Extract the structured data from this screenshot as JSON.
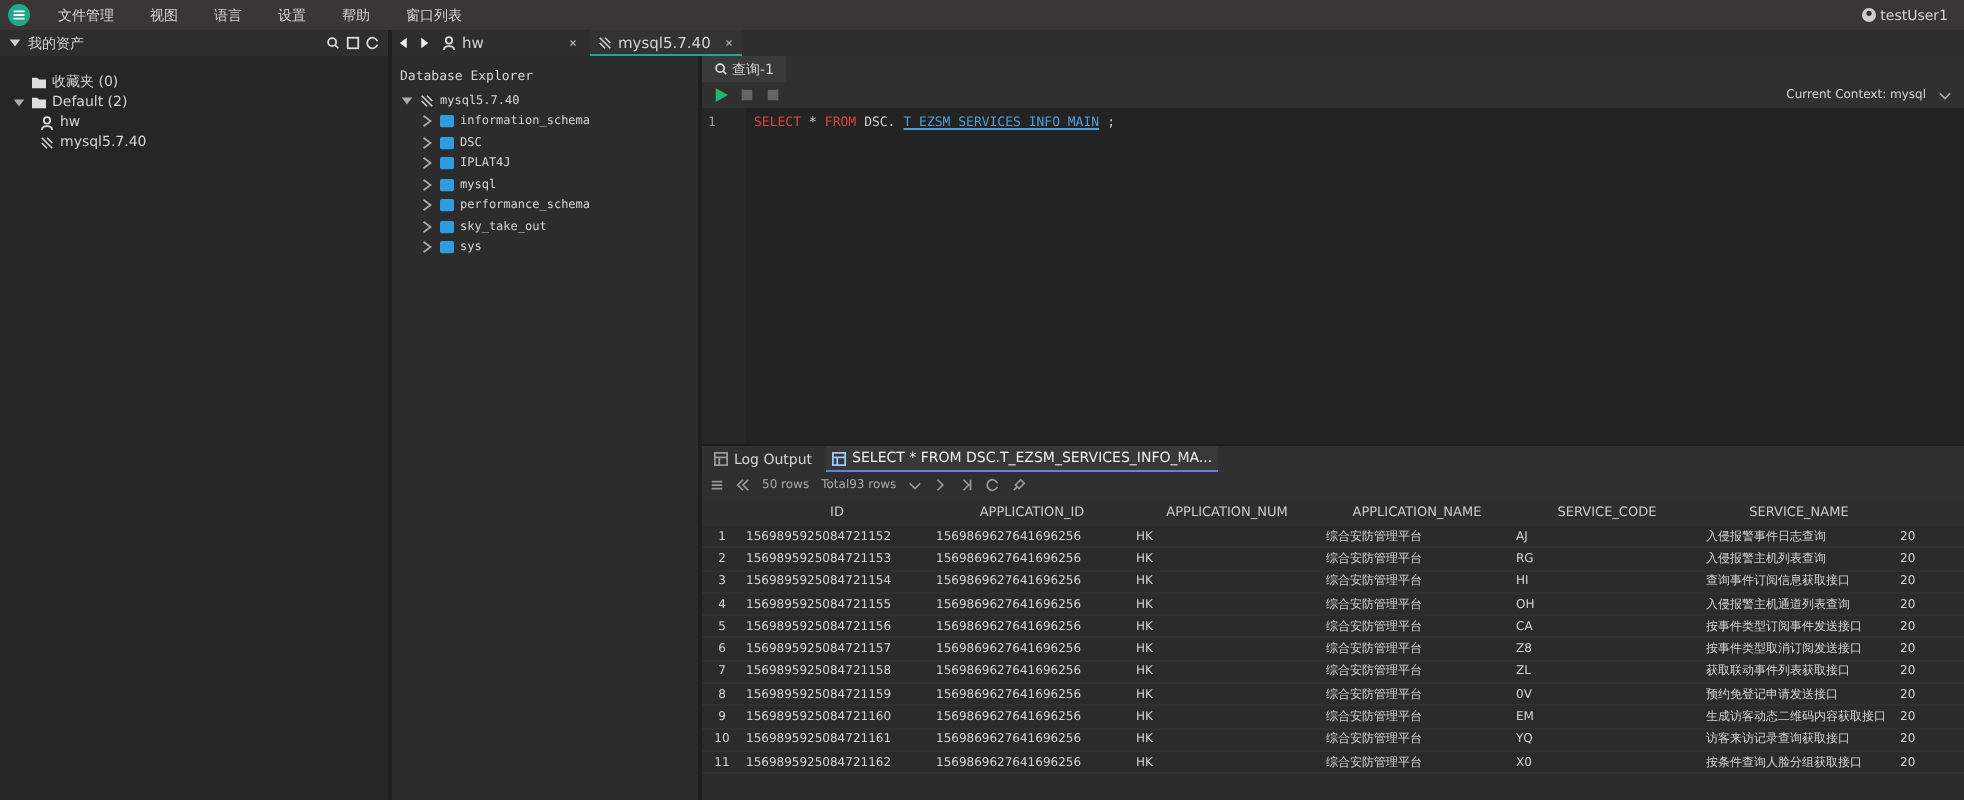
{
  "menu": [
    "文件管理",
    "视图",
    "语言",
    "设置",
    "帮助",
    "窗口列表"
  ],
  "user": "testUser1",
  "assets": {
    "title": "我的资产",
    "items": [
      {
        "label": "收藏夹 (0)",
        "expanded": false
      },
      {
        "label": "Default (2)",
        "expanded": true,
        "children": [
          {
            "kind": "ssh",
            "label": "hw"
          },
          {
            "kind": "db",
            "label": "mysql5.7.40"
          }
        ]
      }
    ]
  },
  "conn_tabs": [
    {
      "kind": "ssh",
      "label": "hw",
      "selected": false
    },
    {
      "kind": "db",
      "label": "mysql5.7.40",
      "selected": true
    }
  ],
  "explorer": {
    "title": "Database Explorer",
    "root": "mysql5.7.40",
    "schemas": [
      "information_schema",
      "DSC",
      "IPLAT4J",
      "mysql",
      "performance_schema",
      "sky_take_out",
      "sys"
    ]
  },
  "query_tab": "查询-1",
  "context": "Current Context: mysql",
  "sql": {
    "line": "1",
    "parts": [
      {
        "kind": "keyword",
        "text": "SELECT"
      },
      {
        "kind": "op",
        "text": "*"
      },
      {
        "kind": "keyword",
        "text": "FROM"
      },
      {
        "kind": "plain",
        "text": "DSC."
      },
      {
        "kind": "table",
        "text": "T_EZSM_SERVICES_INFO_MAIN"
      },
      {
        "kind": "op",
        "text": ";"
      }
    ]
  },
  "result_tabs": [
    {
      "label": "Log Output",
      "selected": false
    },
    {
      "label": "SELECT * FROM DSC.T_EZSM_SERVICES_INFO_MA...",
      "selected": true
    }
  ],
  "paging": {
    "rows": "50 rows",
    "total": "Total93 rows"
  },
  "table": {
    "columns": [
      "ID",
      "APPLICATION_ID",
      "APPLICATION_NUM",
      "APPLICATION_NAME",
      "SERVICE_CODE",
      "SERVICE_NAME"
    ],
    "rows": [
      {
        "row_number": "1",
        "cells": [
          "1569895925084721152",
          "1569869627641696256",
          "HK",
          "综合安防管理平台",
          "AJ",
          "入侵报警事件日志查询",
          "20"
        ]
      },
      {
        "row_number": "2",
        "cells": [
          "1569895925084721153",
          "1569869627641696256",
          "HK",
          "综合安防管理平台",
          "RG",
          "入侵报警主机列表查询",
          "20"
        ]
      },
      {
        "row_number": "3",
        "cells": [
          "1569895925084721154",
          "1569869627641696256",
          "HK",
          "综合安防管理平台",
          "HI",
          "查询事件订阅信息获取接口",
          "20"
        ]
      },
      {
        "row_number": "4",
        "cells": [
          "1569895925084721155",
          "1569869627641696256",
          "HK",
          "综合安防管理平台",
          "OH",
          "入侵报警主机通道列表查询",
          "20"
        ]
      },
      {
        "row_number": "5",
        "cells": [
          "1569895925084721156",
          "1569869627641696256",
          "HK",
          "综合安防管理平台",
          "CA",
          "按事件类型订阅事件发送接口",
          "20"
        ]
      },
      {
        "row_number": "6",
        "cells": [
          "1569895925084721157",
          "1569869627641696256",
          "HK",
          "综合安防管理平台",
          "Z8",
          "按事件类型取消订阅发送接口",
          "20"
        ]
      },
      {
        "row_number": "7",
        "cells": [
          "1569895925084721158",
          "1569869627641696256",
          "HK",
          "综合安防管理平台",
          "ZL",
          "获取联动事件列表获取接口",
          "20"
        ]
      },
      {
        "row_number": "8",
        "cells": [
          "1569895925084721159",
          "1569869627641696256",
          "HK",
          "综合安防管理平台",
          "0V",
          "预约免登记申请发送接口",
          "20"
        ]
      },
      {
        "row_number": "9",
        "cells": [
          "1569895925084721160",
          "1569869627641696256",
          "HK",
          "综合安防管理平台",
          "EM",
          "生成访客动态二维码内容获取接口",
          "20"
        ]
      },
      {
        "row_number": "10",
        "cells": [
          "1569895925084721161",
          "1569869627641696256",
          "HK",
          "综合安防管理平台",
          "YQ",
          "访客来访记录查询获取接口",
          "20"
        ]
      },
      {
        "row_number": "11",
        "cells": [
          "1569895925084721162",
          "1569869627641696256",
          "HK",
          "综合安防管理平台",
          "X0",
          "按条件查询人脸分组获取接口",
          "20"
        ]
      }
    ]
  }
}
